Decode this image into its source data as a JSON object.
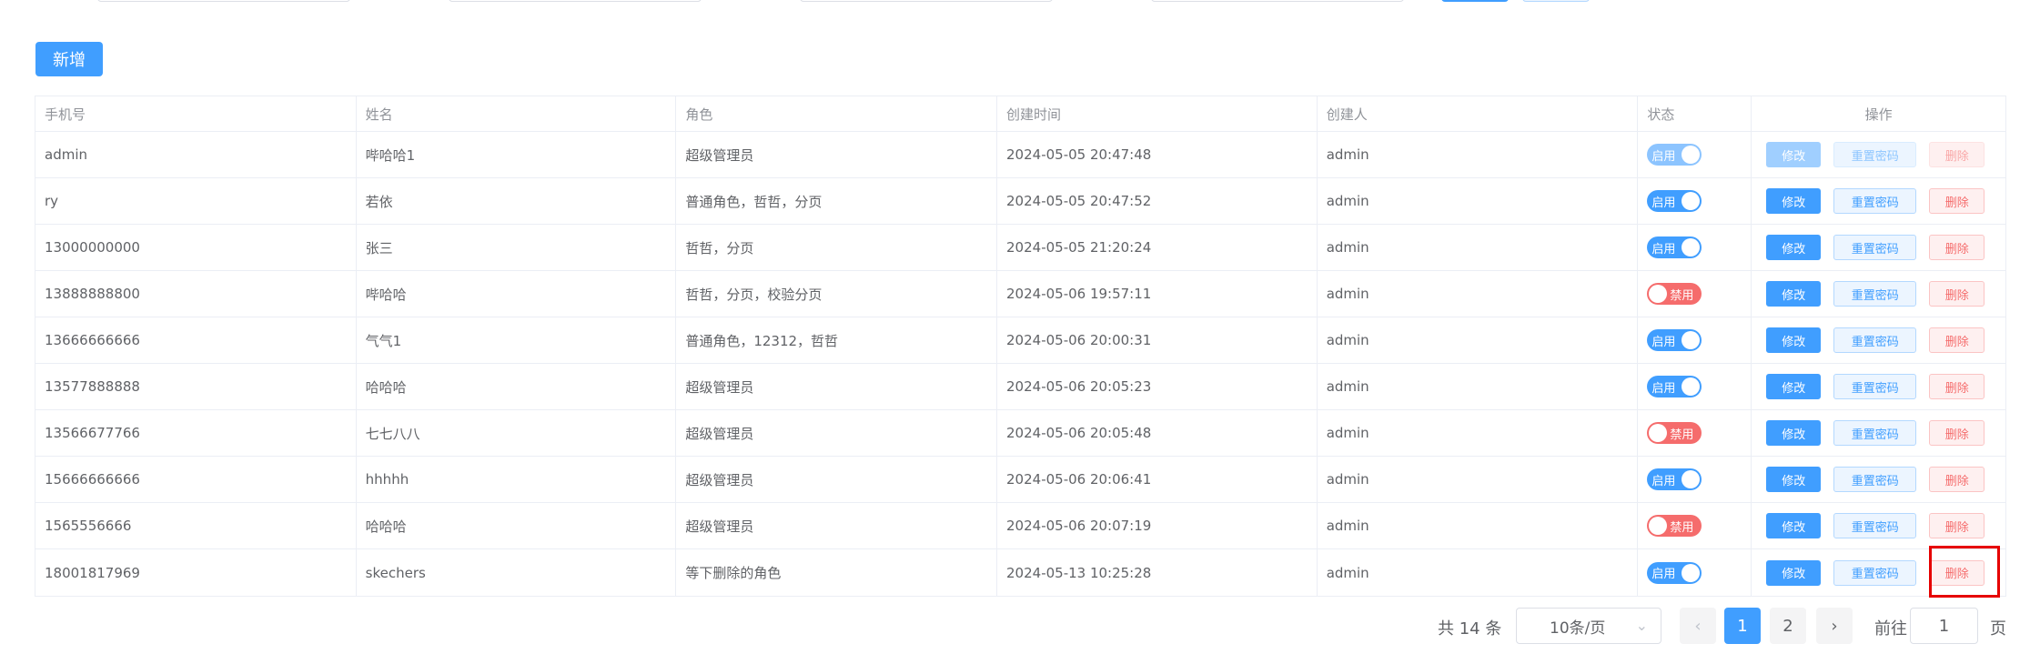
{
  "toolbar": {
    "add_label": "新增"
  },
  "table": {
    "headers": [
      "手机号",
      "姓名",
      "角色",
      "创建时间",
      "创建人",
      "状态",
      "操作"
    ],
    "rows": [
      {
        "phone": "admin",
        "name": "哔哈哈1",
        "role": "超级管理员",
        "created": "2024-05-05 20:47:48",
        "creator": "admin",
        "status": "启用",
        "enabled": true,
        "disabled_actions": true
      },
      {
        "phone": "ry",
        "name": "若依",
        "role": "普通角色，哲哲，分页",
        "created": "2024-05-05 20:47:52",
        "creator": "admin",
        "status": "启用",
        "enabled": true
      },
      {
        "phone": "13000000000",
        "name": "张三",
        "role": "哲哲，分页",
        "created": "2024-05-05 21:20:24",
        "creator": "admin",
        "status": "启用",
        "enabled": true
      },
      {
        "phone": "13888888800",
        "name": "哔哈哈",
        "role": "哲哲，分页，校验分页",
        "created": "2024-05-06 19:57:11",
        "creator": "admin",
        "status": "禁用",
        "enabled": false
      },
      {
        "phone": "13666666666",
        "name": "气气1",
        "role": "普通角色，12312，哲哲",
        "created": "2024-05-06 20:00:31",
        "creator": "admin",
        "status": "启用",
        "enabled": true
      },
      {
        "phone": "13577888888",
        "name": "哈哈哈",
        "role": "超级管理员",
        "created": "2024-05-06 20:05:23",
        "creator": "admin",
        "status": "启用",
        "enabled": true
      },
      {
        "phone": "13566677766",
        "name": "七七八八",
        "role": "超级管理员",
        "created": "2024-05-06 20:05:48",
        "creator": "admin",
        "status": "禁用",
        "enabled": false
      },
      {
        "phone": "15666666666",
        "name": "hhhhh",
        "role": "超级管理员",
        "created": "2024-05-06 20:06:41",
        "creator": "admin",
        "status": "启用",
        "enabled": true
      },
      {
        "phone": "1565556666",
        "name": "哈哈哈",
        "role": "超级管理员",
        "created": "2024-05-06 20:07:19",
        "creator": "admin",
        "status": "禁用",
        "enabled": false
      },
      {
        "phone": "18001817969",
        "name": "skechers",
        "role": "等下删除的角色",
        "created": "2024-05-13 10:25:28",
        "creator": "admin",
        "status": "启用",
        "enabled": true
      }
    ],
    "actions": {
      "edit": "修改",
      "reset": "重置密码",
      "delete": "删除"
    }
  },
  "pagination": {
    "total": "共 14 条",
    "page_size": "10条/页",
    "pages": [
      "1",
      "2"
    ],
    "current": "1",
    "goto_label": "前往",
    "goto_value": "1",
    "page_unit": "页",
    "prev_icon": "‹",
    "next_icon": "›"
  },
  "colors": {
    "primary": "#409eff",
    "danger": "#f56c6c",
    "highlight": "#e60000"
  }
}
